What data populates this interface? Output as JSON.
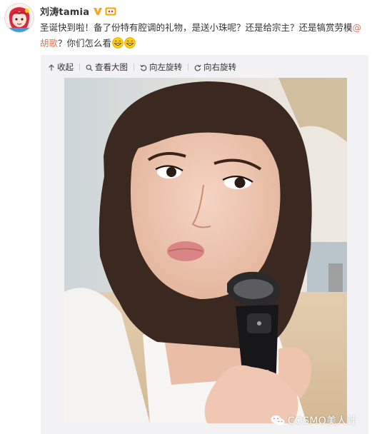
{
  "user": {
    "name": "刘涛tamia",
    "avatar_icon": "avatar-illustration",
    "verified_icon": "verified-v-icon",
    "member_icon": "vip-member-icon"
  },
  "post": {
    "text_main": "圣诞快到啦！备了份特有腔调的礼物，是送小珠呢？还是给宗主？还是犒赏劳模",
    "mention": "@胡歌",
    "text_end": "？你们怎么看",
    "emoji": [
      "grin-emoji",
      "grin-emoji"
    ]
  },
  "toolbar": {
    "collapse_label": "收起",
    "view_large_label": "查看大图",
    "rotate_left_label": "向左旋转",
    "rotate_right_label": "向右旋转"
  },
  "watermark": {
    "text": "COSMO美人计",
    "icon": "wechat-icon"
  },
  "colors": {
    "mention": "#eb7350",
    "panel_bg": "#f2f2f5",
    "verified": "#f5a623"
  }
}
